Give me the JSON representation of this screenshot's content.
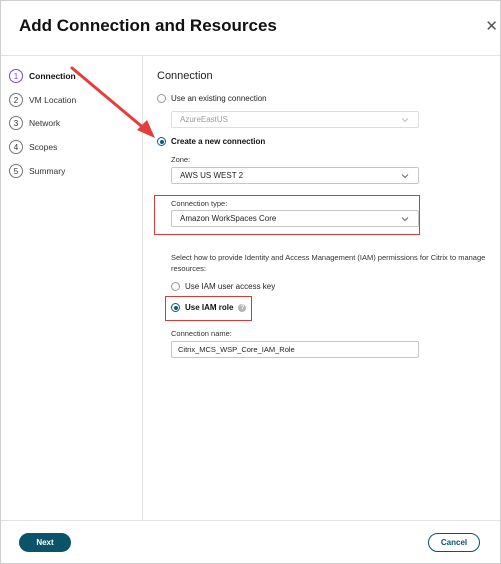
{
  "dialog": {
    "title": "Add Connection and Resources",
    "close_glyph": "✕"
  },
  "steps": [
    {
      "num": "1",
      "label": "Connection",
      "active": true
    },
    {
      "num": "2",
      "label": "VM Location"
    },
    {
      "num": "3",
      "label": "Network"
    },
    {
      "num": "4",
      "label": "Scopes"
    },
    {
      "num": "5",
      "label": "Summary"
    }
  ],
  "connection": {
    "section_title": "Connection",
    "existing_option": "Use an existing connection",
    "existing_value": "AzureEastUS",
    "new_option": "Create a new connection",
    "zone_label": "Zone:",
    "zone_value": "AWS US WEST 2",
    "type_label": "Connection type:",
    "type_value": "Amazon WorkSpaces Core",
    "iam_help": "Select how to provide Identity and Access Management (IAM) permissions for Citrix to manage resources:",
    "iam_key_option": "Use IAM user access key",
    "iam_role_option": "Use IAM role",
    "help_glyph": "?",
    "name_label": "Connection name:",
    "name_value": "Citrix_MCS_WSP_Core_IAM_Role"
  },
  "footer": {
    "next_label": "Next",
    "cancel_label": "Cancel"
  },
  "colors": {
    "accent": "#0b5368",
    "highlight": "#d83a3a",
    "active_step": "#7b4ab8"
  }
}
